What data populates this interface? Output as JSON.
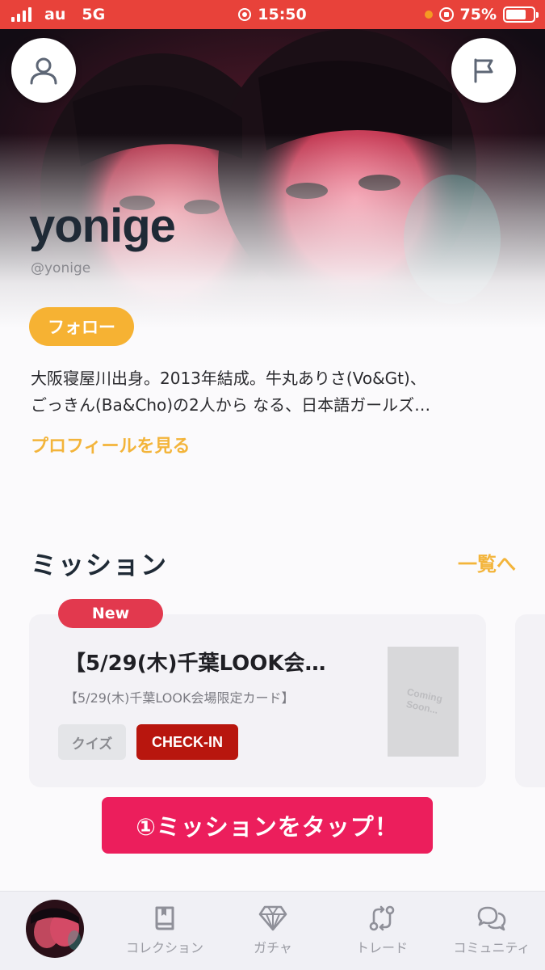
{
  "status_bar": {
    "carrier": "au",
    "network": "5G",
    "time": "15:50",
    "battery": "75%",
    "battery_level": 0.75
  },
  "header": {
    "user_icon": "user-icon",
    "flag_icon": "flag-icon"
  },
  "artist": {
    "name": "yonige",
    "handle": "@yonige",
    "follow_label": "フォロー",
    "bio_line1": "大阪寝屋川出身。2013年結成。牛丸ありさ(Vo&Gt)、",
    "bio_line2": "ごっきん(Ba&Cho)の2人から なる、日本語ガールズ…",
    "profile_link": "プロフィールを見る"
  },
  "missions": {
    "title": "ミッション",
    "view_all": "一覧へ",
    "cards": [
      {
        "badge": "New",
        "title": "【5/29(木)千葉LOOK会…",
        "subtitle": "【5/29(木)千葉LOOK会場限定カード】",
        "tags": [
          "クイズ",
          "CHECK-IN"
        ],
        "thumbnail_text": "Coming\nSoon..."
      }
    ]
  },
  "annotation": {
    "text": "①ミッションをタップ！"
  },
  "bottom_nav": {
    "items": [
      {
        "label": "コレクション",
        "icon": "book-icon"
      },
      {
        "label": "ガチャ",
        "icon": "diamond-icon"
      },
      {
        "label": "トレード",
        "icon": "trade-icon"
      },
      {
        "label": "コミュニティ",
        "icon": "chat-icon"
      }
    ]
  },
  "colors": {
    "status_bar": "#e8423a",
    "accent_yellow": "#f6b233",
    "new_badge": "#e2394e",
    "checkin": "#b8160e",
    "banner": "#ec1e5c"
  }
}
